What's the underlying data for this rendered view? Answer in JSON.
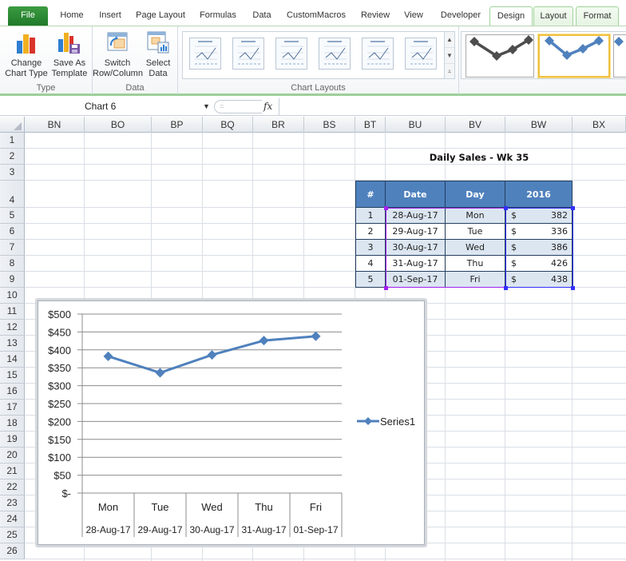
{
  "ribbon": {
    "tabs": [
      {
        "label": "File",
        "kind": "file"
      },
      {
        "label": "Home"
      },
      {
        "label": "Insert"
      },
      {
        "label": "Page Layout"
      },
      {
        "label": "Formulas"
      },
      {
        "label": "Data"
      },
      {
        "label": "CustomMacros"
      },
      {
        "label": "Review"
      },
      {
        "label": "View"
      },
      {
        "label": "Developer"
      },
      {
        "label": "Design",
        "kind": "ctx-active"
      },
      {
        "label": "Layout",
        "kind": "ctx"
      },
      {
        "label": "Format",
        "kind": "ctx"
      }
    ],
    "groups": {
      "type": {
        "label": "Type",
        "change_chart_type": "Change Chart Type",
        "change_chart_type_l1": "Change",
        "change_chart_type_l2": "Chart Type",
        "save_template_l1": "Save As",
        "save_template_l2": "Template"
      },
      "data": {
        "label": "Data",
        "switch_l1": "Switch",
        "switch_l2": "Row/Column",
        "select_l1": "Select",
        "select_l2": "Data"
      },
      "layouts": {
        "label": "Chart Layouts",
        "count": 6
      },
      "styles": {
        "selected_index": 1
      }
    },
    "colors": {
      "file_tab": "#2a8a33",
      "context_border": "#9ed29a",
      "style_gray": "#4d4d4d",
      "style_blue": "#4f81bd",
      "selected_style_border": "#f0c040"
    }
  },
  "formula_bar": {
    "name_box": "Chart 6",
    "fx_label": "fx",
    "formula": ""
  },
  "grid": {
    "columns": [
      "BN",
      "BO",
      "BP",
      "BQ",
      "BR",
      "BS",
      "BT",
      "BU",
      "BV",
      "BW",
      "BX"
    ],
    "rows": [
      "1",
      "2",
      "3",
      "4",
      "5",
      "6",
      "7",
      "8",
      "9",
      "10",
      "11",
      "12",
      "13",
      "14",
      "15",
      "16",
      "17",
      "18",
      "19",
      "20",
      "21",
      "22",
      "23",
      "24",
      "25",
      "26"
    ]
  },
  "sheet_table": {
    "title": "Daily Sales - Wk 35",
    "headers": [
      "#",
      "Date",
      "Day",
      "2016"
    ],
    "rows": [
      {
        "n": "1",
        "date": "28-Aug-17",
        "day": "Mon",
        "currency": "$",
        "value": "382"
      },
      {
        "n": "2",
        "date": "29-Aug-17",
        "day": "Tue",
        "currency": "$",
        "value": "336"
      },
      {
        "n": "3",
        "date": "30-Aug-17",
        "day": "Wed",
        "currency": "$",
        "value": "386"
      },
      {
        "n": "4",
        "date": "31-Aug-17",
        "day": "Thu",
        "currency": "$",
        "value": "426"
      },
      {
        "n": "5",
        "date": "01-Sep-17",
        "day": "Fri",
        "currency": "$",
        "value": "438"
      }
    ],
    "colors": {
      "header_bg": "#4f81bd",
      "alt_row_bg": "#dce6f1",
      "border": "#243f60",
      "category_range_highlight": "#a020f0",
      "value_range_highlight": "#3030ff"
    }
  },
  "chart_data": {
    "type": "line",
    "title": "",
    "categories": [
      {
        "day": "Mon",
        "date": "28-Aug-17"
      },
      {
        "day": "Tue",
        "date": "29-Aug-17"
      },
      {
        "day": "Wed",
        "date": "30-Aug-17"
      },
      {
        "day": "Thu",
        "date": "31-Aug-17"
      },
      {
        "day": "Fri",
        "date": "01-Sep-17"
      }
    ],
    "series": [
      {
        "name": "Series1",
        "values": [
          382,
          336,
          386,
          426,
          438
        ],
        "color": "#4f81bd",
        "marker": "diamond"
      }
    ],
    "y_ticks": [
      "$500",
      "$450",
      "$400",
      "$350",
      "$300",
      "$250",
      "$200",
      "$150",
      "$100",
      "$50",
      "$-"
    ],
    "y_tick_values": [
      500,
      450,
      400,
      350,
      300,
      250,
      200,
      150,
      100,
      50,
      0
    ],
    "ylim": [
      0,
      500
    ],
    "grid": true,
    "legend": "right",
    "xlabel": "",
    "ylabel": ""
  }
}
